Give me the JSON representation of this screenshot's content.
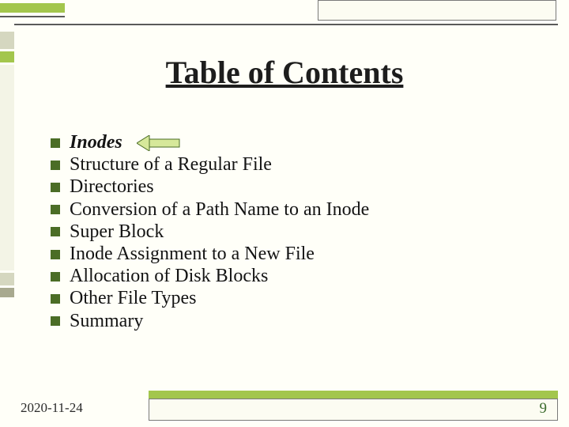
{
  "title": "Table of Contents",
  "current_index": 0,
  "items": [
    "Inodes",
    "Structure of a Regular File",
    "Directories",
    "Conversion of a Path Name to an Inode",
    "Super Block",
    "Inode Assignment to a New File",
    "Allocation of Disk Blocks",
    "Other File Types",
    "Summary"
  ],
  "footer": {
    "date": "2020-11-24",
    "slide_number": "9"
  },
  "colors": {
    "accent_green": "#a3c64d",
    "bullet_green": "#4b6d26"
  }
}
